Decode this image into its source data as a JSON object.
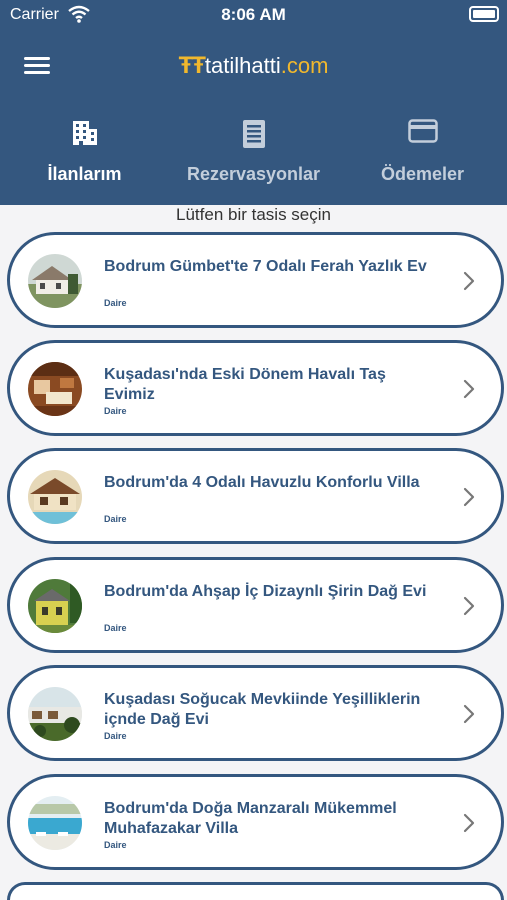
{
  "status_bar": {
    "carrier": "Carrier",
    "time": "8:06 AM"
  },
  "header": {
    "logo_mark": "ŦŦ",
    "logo_text_white": "tatilhatti",
    "logo_text_gold": ".com",
    "hint": "Lütfen bir tasis seçin"
  },
  "tabs": [
    {
      "label": "İlanlarım",
      "icon": "building-icon",
      "active": true
    },
    {
      "label": "Rezervasyonlar",
      "icon": "document-icon",
      "active": false
    },
    {
      "label": "Ödemeler",
      "icon": "credit-card-icon",
      "active": false
    }
  ],
  "listings": [
    {
      "title": "Bodrum Gümbet'te 7 Odalı Ferah Yazlık Ev",
      "type": "Daire"
    },
    {
      "title": "Kuşadası'nda Eski Dönem Havalı Taş Evimiz",
      "type": "Daire"
    },
    {
      "title": "Bodrum'da 4 Odalı Havuzlu Konforlu Villa",
      "type": "Daire"
    },
    {
      "title": "Bodrum'da Ahşap İç Dizaynlı Şirin Dağ Evi",
      "type": "Daire"
    },
    {
      "title": "Kuşadası Soğucak Mevkiinde Yeşilliklerin içnde Dağ Evi",
      "type": "Daire"
    },
    {
      "title": "Bodrum'da Doğa Manzaralı Mükemmel Muhafazakar Villa",
      "type": "Daire"
    }
  ],
  "colors": {
    "primary": "#34577f",
    "accent": "#f1b82d"
  }
}
